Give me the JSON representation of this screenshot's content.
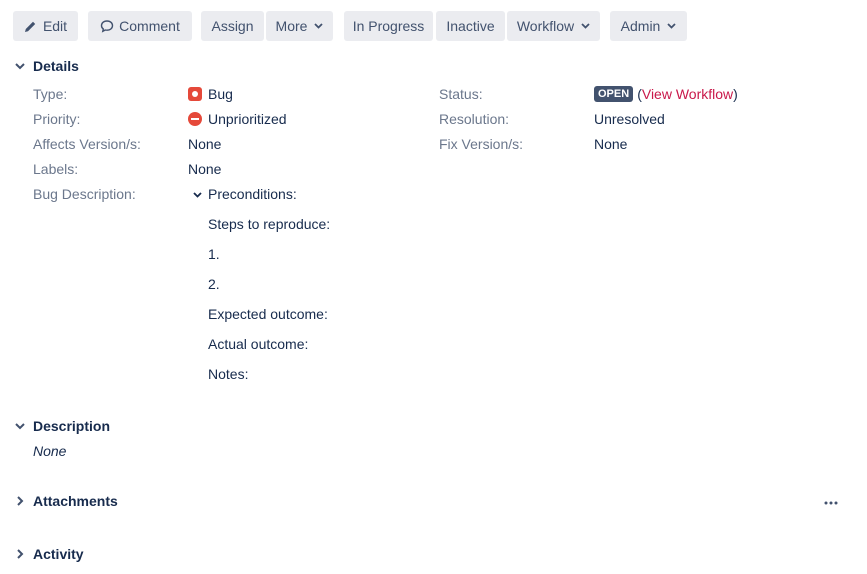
{
  "toolbar": {
    "edit_label": "Edit",
    "comment_label": "Comment",
    "assign_label": "Assign",
    "more_label": "More",
    "in_progress_label": "In Progress",
    "inactive_label": "Inactive",
    "workflow_label": "Workflow",
    "admin_label": "Admin"
  },
  "details": {
    "section_title": "Details",
    "fields": {
      "type": {
        "label": "Type:",
        "value": "Bug",
        "icon": "bug-icon"
      },
      "priority": {
        "label": "Priority:",
        "value": "Unprioritized",
        "icon": "priority-unprioritized-icon"
      },
      "affects_version": {
        "label": "Affects Version/s:",
        "value": "None"
      },
      "labels": {
        "label": "Labels:",
        "value": "None"
      },
      "bug_description": {
        "label": "Bug Description:"
      },
      "status": {
        "label": "Status:",
        "value": "OPEN",
        "link_open": "(",
        "link_text": "View Workflow",
        "link_close": ")"
      },
      "resolution": {
        "label": "Resolution:",
        "value": "Unresolved"
      },
      "fix_version": {
        "label": "Fix Version/s:",
        "value": "None"
      }
    },
    "bug_description_lines": [
      "Preconditions:",
      "Steps to reproduce:",
      "1.",
      "2.",
      "Expected outcome:",
      "Actual outcome:",
      "Notes:"
    ]
  },
  "description": {
    "section_title": "Description",
    "value": "None"
  },
  "attachments": {
    "section_title": "Attachments"
  },
  "activity": {
    "section_title": "Activity"
  },
  "colors": {
    "button_bg": "#ebecf0",
    "button_text": "#42526e",
    "label_text": "#6b778c",
    "value_text": "#172b4d",
    "bug_red": "#e5493a",
    "status_lozenge": "#42526e",
    "link": "#c9184a"
  }
}
